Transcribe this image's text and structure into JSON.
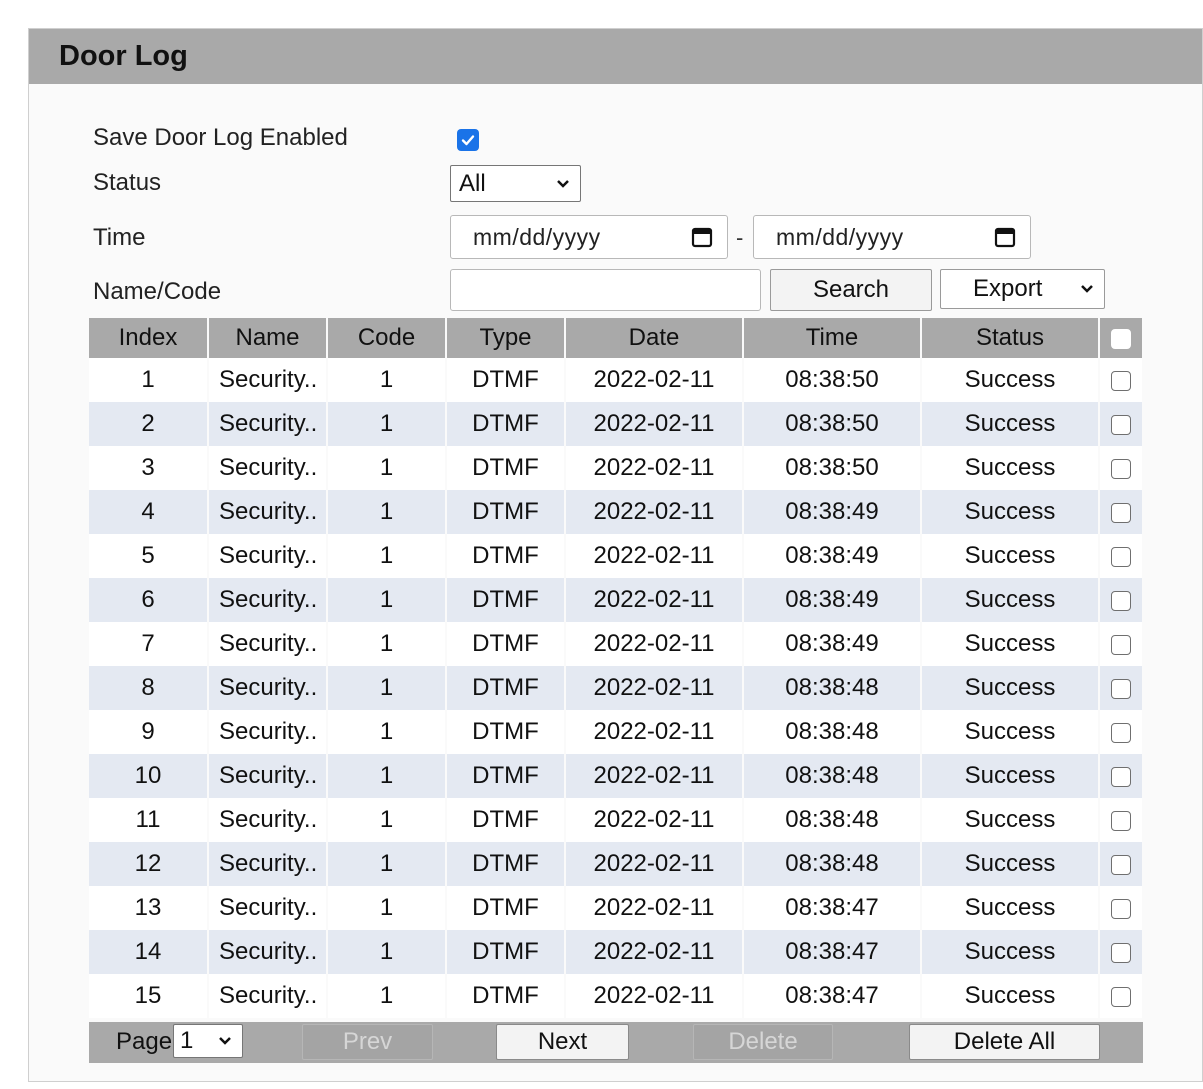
{
  "panel": {
    "title": "Door Log"
  },
  "form": {
    "save_label": "Save Door Log Enabled",
    "save_checked": true,
    "status_label": "Status",
    "status_value": "All",
    "time_label": "Time",
    "date_from_placeholder": "mm/dd/yyyy",
    "date_separator": "-",
    "date_to_placeholder": "mm/dd/yyyy",
    "name_code_label": "Name/Code",
    "name_code_value": "",
    "search_label": "Search",
    "export_label": "Export"
  },
  "table": {
    "columns": [
      "Index",
      "Name",
      "Code",
      "Type",
      "Date",
      "Time",
      "Status"
    ],
    "rows": [
      [
        "1",
        "Security..",
        "1",
        "DTMF",
        "2022-02-11",
        "08:38:50",
        "Success"
      ],
      [
        "2",
        "Security..",
        "1",
        "DTMF",
        "2022-02-11",
        "08:38:50",
        "Success"
      ],
      [
        "3",
        "Security..",
        "1",
        "DTMF",
        "2022-02-11",
        "08:38:50",
        "Success"
      ],
      [
        "4",
        "Security..",
        "1",
        "DTMF",
        "2022-02-11",
        "08:38:49",
        "Success"
      ],
      [
        "5",
        "Security..",
        "1",
        "DTMF",
        "2022-02-11",
        "08:38:49",
        "Success"
      ],
      [
        "6",
        "Security..",
        "1",
        "DTMF",
        "2022-02-11",
        "08:38:49",
        "Success"
      ],
      [
        "7",
        "Security..",
        "1",
        "DTMF",
        "2022-02-11",
        "08:38:49",
        "Success"
      ],
      [
        "8",
        "Security..",
        "1",
        "DTMF",
        "2022-02-11",
        "08:38:48",
        "Success"
      ],
      [
        "9",
        "Security..",
        "1",
        "DTMF",
        "2022-02-11",
        "08:38:48",
        "Success"
      ],
      [
        "10",
        "Security..",
        "1",
        "DTMF",
        "2022-02-11",
        "08:38:48",
        "Success"
      ],
      [
        "11",
        "Security..",
        "1",
        "DTMF",
        "2022-02-11",
        "08:38:48",
        "Success"
      ],
      [
        "12",
        "Security..",
        "1",
        "DTMF",
        "2022-02-11",
        "08:38:48",
        "Success"
      ],
      [
        "13",
        "Security..",
        "1",
        "DTMF",
        "2022-02-11",
        "08:38:47",
        "Success"
      ],
      [
        "14",
        "Security..",
        "1",
        "DTMF",
        "2022-02-11",
        "08:38:47",
        "Success"
      ],
      [
        "15",
        "Security..",
        "1",
        "DTMF",
        "2022-02-11",
        "08:38:47",
        "Success"
      ]
    ]
  },
  "footer": {
    "page_label": "Page",
    "page_value": "1",
    "prev_label": "Prev",
    "next_label": "Next",
    "delete_label": "Delete",
    "delete_all_label": "Delete All"
  },
  "colors": {
    "header_bg": "#a9a9a9",
    "row_alt_bg": "#e4e9f2",
    "checkbox_accent": "#1a73e8"
  },
  "icons": [
    "check-icon",
    "chevron-down-icon",
    "calendar-icon"
  ]
}
